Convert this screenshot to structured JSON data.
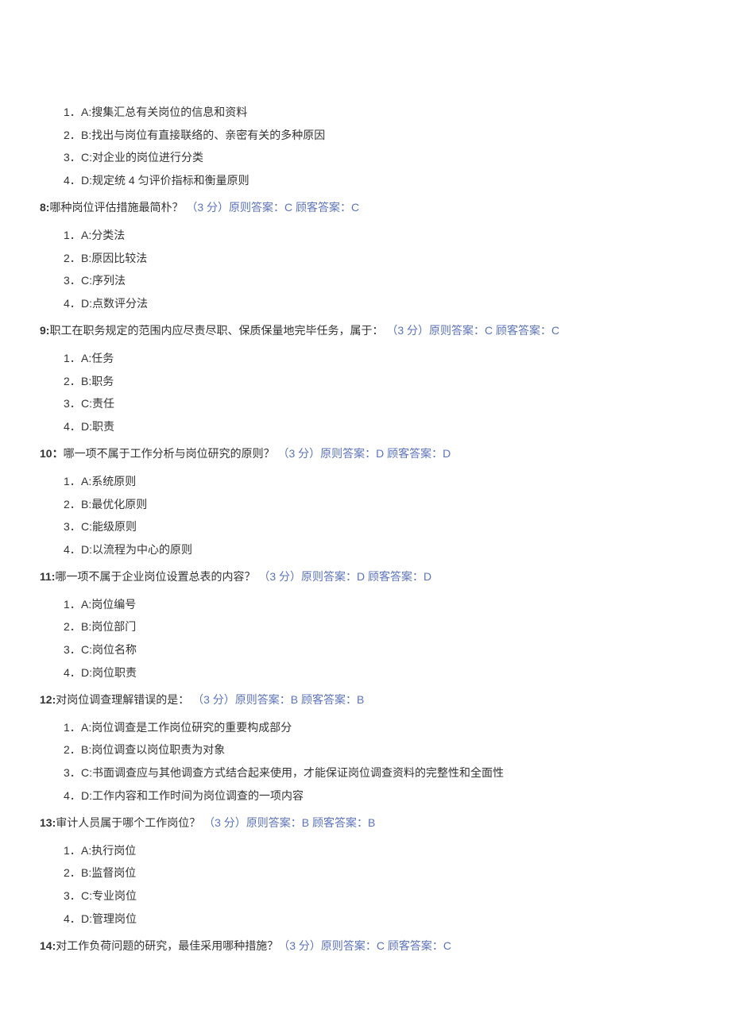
{
  "pre_options": [
    {
      "n": "1．",
      "label": "A:",
      "text": "搜集汇总有关岗位的信息和资料"
    },
    {
      "n": "2．",
      "label": "B:",
      "text": "找出与岗位有直接联络的、亲密有关的多种原因"
    },
    {
      "n": "3．",
      "label": "C:",
      "text": "对企业的岗位进行分类"
    },
    {
      "n": "4．",
      "label": "D:",
      "text": "规定统 4 匀评价指标和衡量原则"
    }
  ],
  "questions": [
    {
      "num": "8:",
      "text": "哪种岗位评估措施最简朴？ ",
      "score": "（3 分）",
      "ans_correct": "原则答案：C ",
      "ans_user": "顾客答案：C",
      "options": [
        {
          "n": "1．",
          "label": "A:",
          "text": "分类法"
        },
        {
          "n": "2．",
          "label": "B:",
          "text": "原因比较法"
        },
        {
          "n": "3．",
          "label": "C:",
          "text": "序列法"
        },
        {
          "n": "4．",
          "label": "D:",
          "text": "点数评分法"
        }
      ]
    },
    {
      "num": "9:",
      "text": "职工在职务规定的范围内应尽责尽职、保质保量地完毕任务，属于： ",
      "score": "（3 分）",
      "ans_correct": "原则答案：C ",
      "ans_user": "顾客答案：C",
      "options": [
        {
          "n": "1．",
          "label": "A:",
          "text": "任务"
        },
        {
          "n": "2．",
          "label": "B:",
          "text": "职务"
        },
        {
          "n": "3．",
          "label": "C:",
          "text": "责任"
        },
        {
          "n": "4．",
          "label": "D:",
          "text": "职责"
        }
      ]
    },
    {
      "num": "10：",
      "text": "哪一项不属于工作分析与岗位研究的原则？ ",
      "score": "（3 分）",
      "ans_correct": "原则答案：D ",
      "ans_user": "顾客答案：D",
      "options": [
        {
          "n": "1．",
          "label": "A:",
          "text": "系统原则"
        },
        {
          "n": "2．",
          "label": "B:",
          "text": "最优化原则"
        },
        {
          "n": "3．",
          "label": "C:",
          "text": "能级原则"
        },
        {
          "n": "4．",
          "label": "D:",
          "text": "以流程为中心的原则"
        }
      ]
    },
    {
      "num": "11:",
      "text": "哪一项不属于企业岗位设置总表的内容？ ",
      "score": "（3 分）",
      "ans_correct": "原则答案：D ",
      "ans_user": "顾客答案：D",
      "options": [
        {
          "n": "1．",
          "label": "A:",
          "text": "岗位编号"
        },
        {
          "n": "2．",
          "label": "B:",
          "text": "岗位部门"
        },
        {
          "n": "3．",
          "label": "C:",
          "text": "岗位名称"
        },
        {
          "n": "4．",
          "label": "D:",
          "text": "岗位职责"
        }
      ]
    },
    {
      "num": "12:",
      "text": "对岗位调查理解错误的是： ",
      "score": "（3 分）",
      "ans_correct": "原则答案：B ",
      "ans_user": "顾客答案：B",
      "options": [
        {
          "n": "1．",
          "label": "A:",
          "text": "岗位调查是工作岗位研究的重要构成部分"
        },
        {
          "n": "2．",
          "label": "B:",
          "text": "岗位调查以岗位职责为对象"
        },
        {
          "n": "3．",
          "label": "C:",
          "text": "书面调查应与其他调查方式结合起来使用，才能保证岗位调查资料的完整性和全面性"
        },
        {
          "n": "4．",
          "label": "D:",
          "text": "工作内容和工作时间为岗位调查的一项内容"
        }
      ]
    },
    {
      "num": "13:",
      "text": "审计人员属于哪个工作岗位？ ",
      "score": "（3 分）",
      "ans_correct": "原则答案：B ",
      "ans_user": "顾客答案：B",
      "options": [
        {
          "n": "1．",
          "label": "A:",
          "text": "执行岗位"
        },
        {
          "n": "2．",
          "label": "B:",
          "text": "监督岗位"
        },
        {
          "n": "3．",
          "label": "C:",
          "text": "专业岗位"
        },
        {
          "n": "4．",
          "label": "D:",
          "text": "管理岗位"
        }
      ]
    },
    {
      "num": "14:",
      "text": "对工作负荷问题的研究，最佳采用哪种措施？",
      "score": "（3 分）",
      "ans_correct": "原则答案：C ",
      "ans_user": "顾客答案：C",
      "options": []
    }
  ]
}
